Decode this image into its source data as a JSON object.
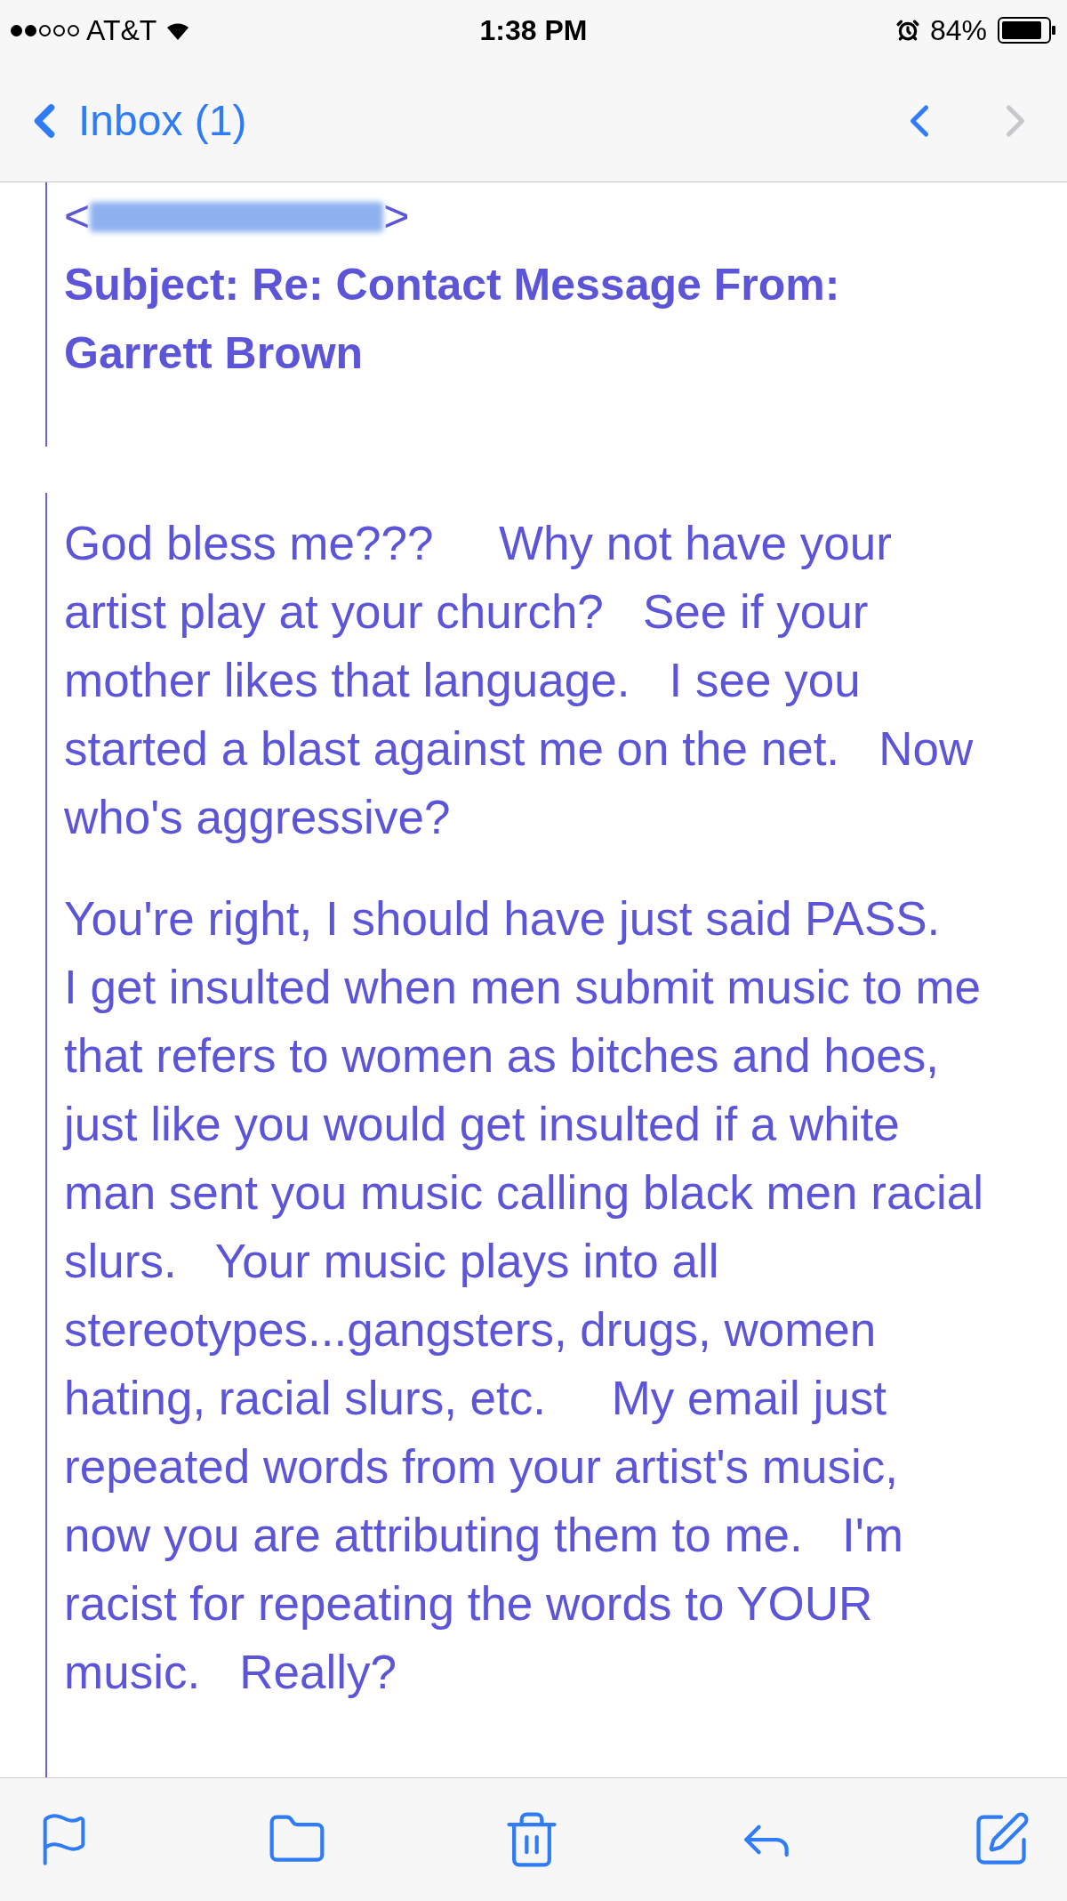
{
  "status_bar": {
    "carrier": "AT&T",
    "time": "1:38 PM",
    "battery": "84%"
  },
  "nav": {
    "back": "Inbox (1)",
    "previous_disabled": false,
    "next_disabled": true
  },
  "header": {
    "address_open": "<",
    "address_close": ">",
    "subject": "Subject: Re: Contact Message From:",
    "subject_cont": "Garrett Brown"
  },
  "body": [
    {
      "lines": [
        "God bless me???     Why not have your",
        "artist play at your church?   See if your",
        "mother likes that language.   I see you",
        "started a blast against me on the net.   Now",
        "who's aggressive?"
      ]
    },
    {
      "lines": [
        "You're right, I should have just said PASS.",
        "I get insulted when men submit music to me",
        "that refers to women as bitches and hoes,",
        "just like you would get insulted if a white",
        "man sent you music calling black men racial",
        "slurs.   Your music plays into all",
        "stereotypes...gangsters, drugs, women",
        "hating, racial slurs, etc.     My email just",
        "repeated words from your artist's music,",
        "now you are attributing them to me.   I'm",
        "racist for repeating the words to YOUR",
        "music.   Really?"
      ]
    }
  ]
}
